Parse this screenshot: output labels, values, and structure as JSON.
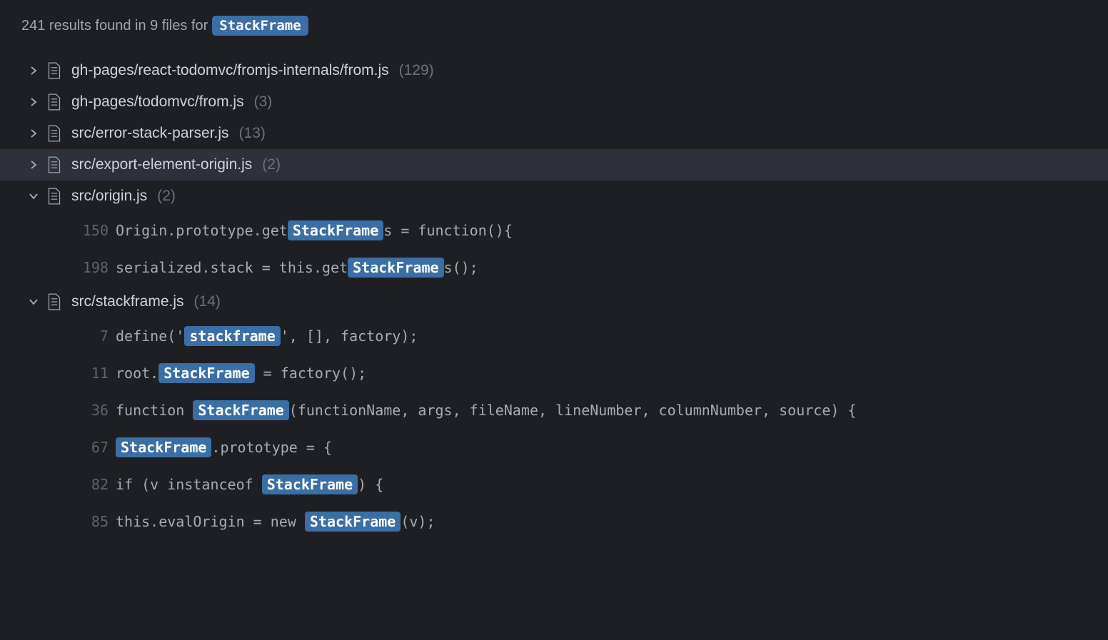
{
  "header": {
    "results_count": "241",
    "results_text_prefix": "241 results found in 9 files for",
    "search_term": "StackFrame"
  },
  "files": [
    {
      "path": "gh-pages/react-todomvc/fromjs-internals/from.js",
      "count": "(129)",
      "expanded": false,
      "selected": false
    },
    {
      "path": "gh-pages/todomvc/from.js",
      "count": "(3)",
      "expanded": false,
      "selected": false
    },
    {
      "path": "src/error-stack-parser.js",
      "count": "(13)",
      "expanded": false,
      "selected": false
    },
    {
      "path": "src/export-element-origin.js",
      "count": "(2)",
      "expanded": false,
      "selected": true
    },
    {
      "path": "src/origin.js",
      "count": "(2)",
      "expanded": true,
      "selected": false,
      "matches": [
        {
          "line": "150",
          "segments": [
            {
              "t": "Origin.prototype.get",
              "h": false
            },
            {
              "t": "StackFrame",
              "h": true
            },
            {
              "t": "s = function(){",
              "h": false
            }
          ]
        },
        {
          "line": "198",
          "segments": [
            {
              "t": "serialized.stack = this.get",
              "h": false
            },
            {
              "t": "StackFrame",
              "h": true
            },
            {
              "t": "s();",
              "h": false
            }
          ]
        }
      ]
    },
    {
      "path": "src/stackframe.js",
      "count": "(14)",
      "expanded": true,
      "selected": false,
      "matches": [
        {
          "line": "7",
          "segments": [
            {
              "t": "define('",
              "h": false
            },
            {
              "t": "stackframe",
              "h": true
            },
            {
              "t": "', [], factory);",
              "h": false
            }
          ]
        },
        {
          "line": "11",
          "segments": [
            {
              "t": "root.",
              "h": false
            },
            {
              "t": "StackFrame",
              "h": true
            },
            {
              "t": " = factory();",
              "h": false
            }
          ]
        },
        {
          "line": "36",
          "segments": [
            {
              "t": "function ",
              "h": false
            },
            {
              "t": "StackFrame",
              "h": true
            },
            {
              "t": "(functionName, args, fileName, lineNumber, columnNumber, source) {",
              "h": false
            }
          ]
        },
        {
          "line": "67",
          "segments": [
            {
              "t": "StackFrame",
              "h": true
            },
            {
              "t": ".prototype = {",
              "h": false
            }
          ]
        },
        {
          "line": "82",
          "segments": [
            {
              "t": "if (v instanceof ",
              "h": false
            },
            {
              "t": "StackFrame",
              "h": true
            },
            {
              "t": ") {",
              "h": false
            }
          ]
        },
        {
          "line": "85",
          "segments": [
            {
              "t": "this.evalOrigin = new ",
              "h": false
            },
            {
              "t": "StackFrame",
              "h": true
            },
            {
              "t": "(v);",
              "h": false
            }
          ]
        }
      ]
    }
  ]
}
